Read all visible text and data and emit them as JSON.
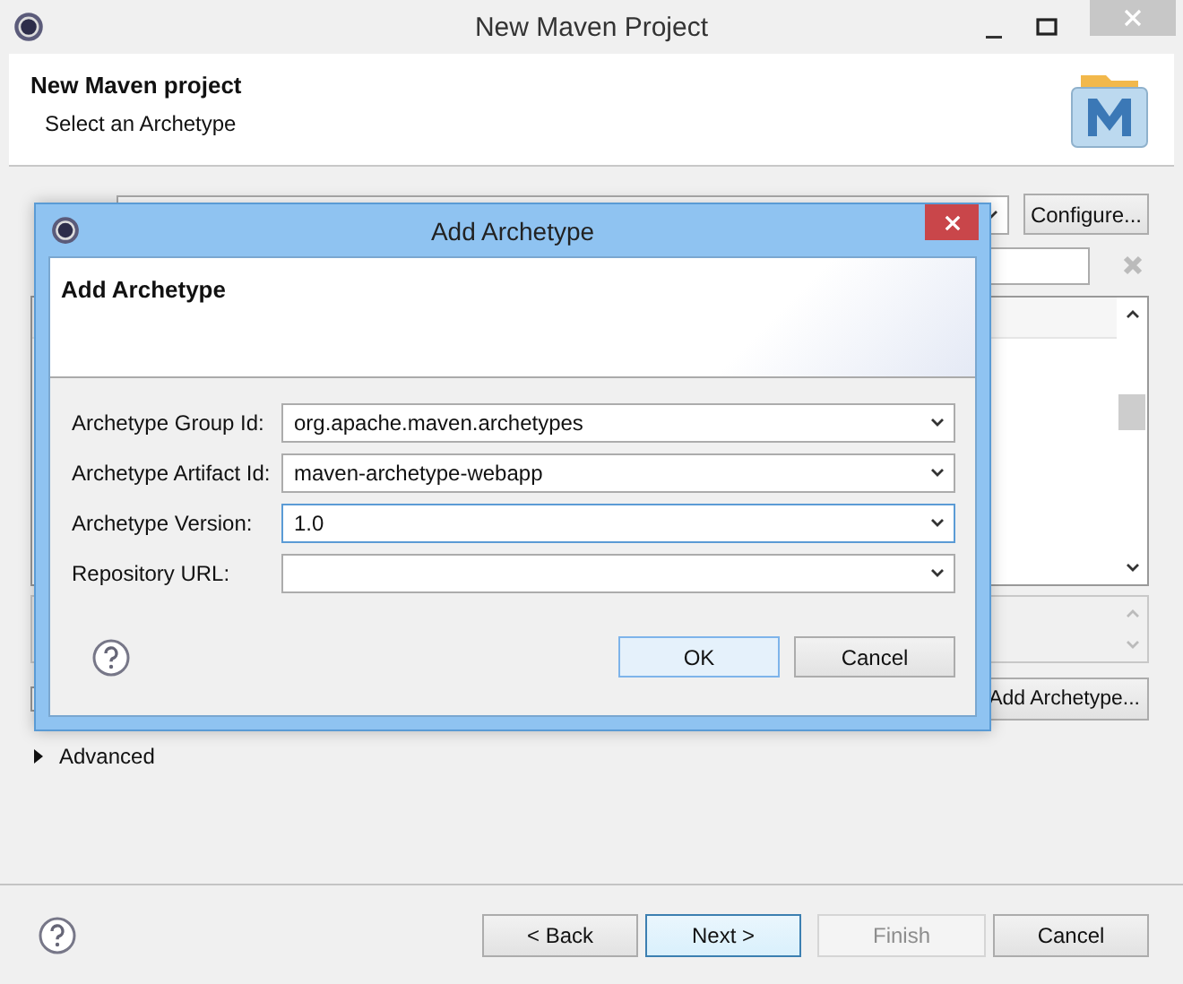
{
  "window": {
    "title": "New Maven Project"
  },
  "header": {
    "title": "New Maven project",
    "subtitle": "Select an Archetype"
  },
  "configure_button": "Configure...",
  "add_archetype_button": "Add Archetype...",
  "advanced": {
    "label": "Advanced",
    "expanded": false
  },
  "footer_buttons": [
    {
      "label": "< Back",
      "disabled": false,
      "focused": false
    },
    {
      "label": "Next >",
      "disabled": false,
      "focused": true
    },
    {
      "label": "Finish",
      "disabled": true,
      "focused": false
    },
    {
      "label": "Cancel",
      "disabled": false,
      "focused": false
    }
  ],
  "dialog": {
    "title": "Add Archetype",
    "heading": "Add Archetype",
    "fields": [
      {
        "label": "Archetype Group Id:",
        "value": "org.apache.maven.archetypes",
        "focused": false
      },
      {
        "label": "Archetype Artifact Id:",
        "value": "maven-archetype-webapp",
        "focused": false
      },
      {
        "label": "Archetype Version:",
        "value": "1.0",
        "focused": true
      },
      {
        "label": "Repository URL:",
        "focused": false
      }
    ],
    "buttons": [
      {
        "label": "OK",
        "default": true
      },
      {
        "label": "Cancel",
        "default": false
      }
    ]
  }
}
